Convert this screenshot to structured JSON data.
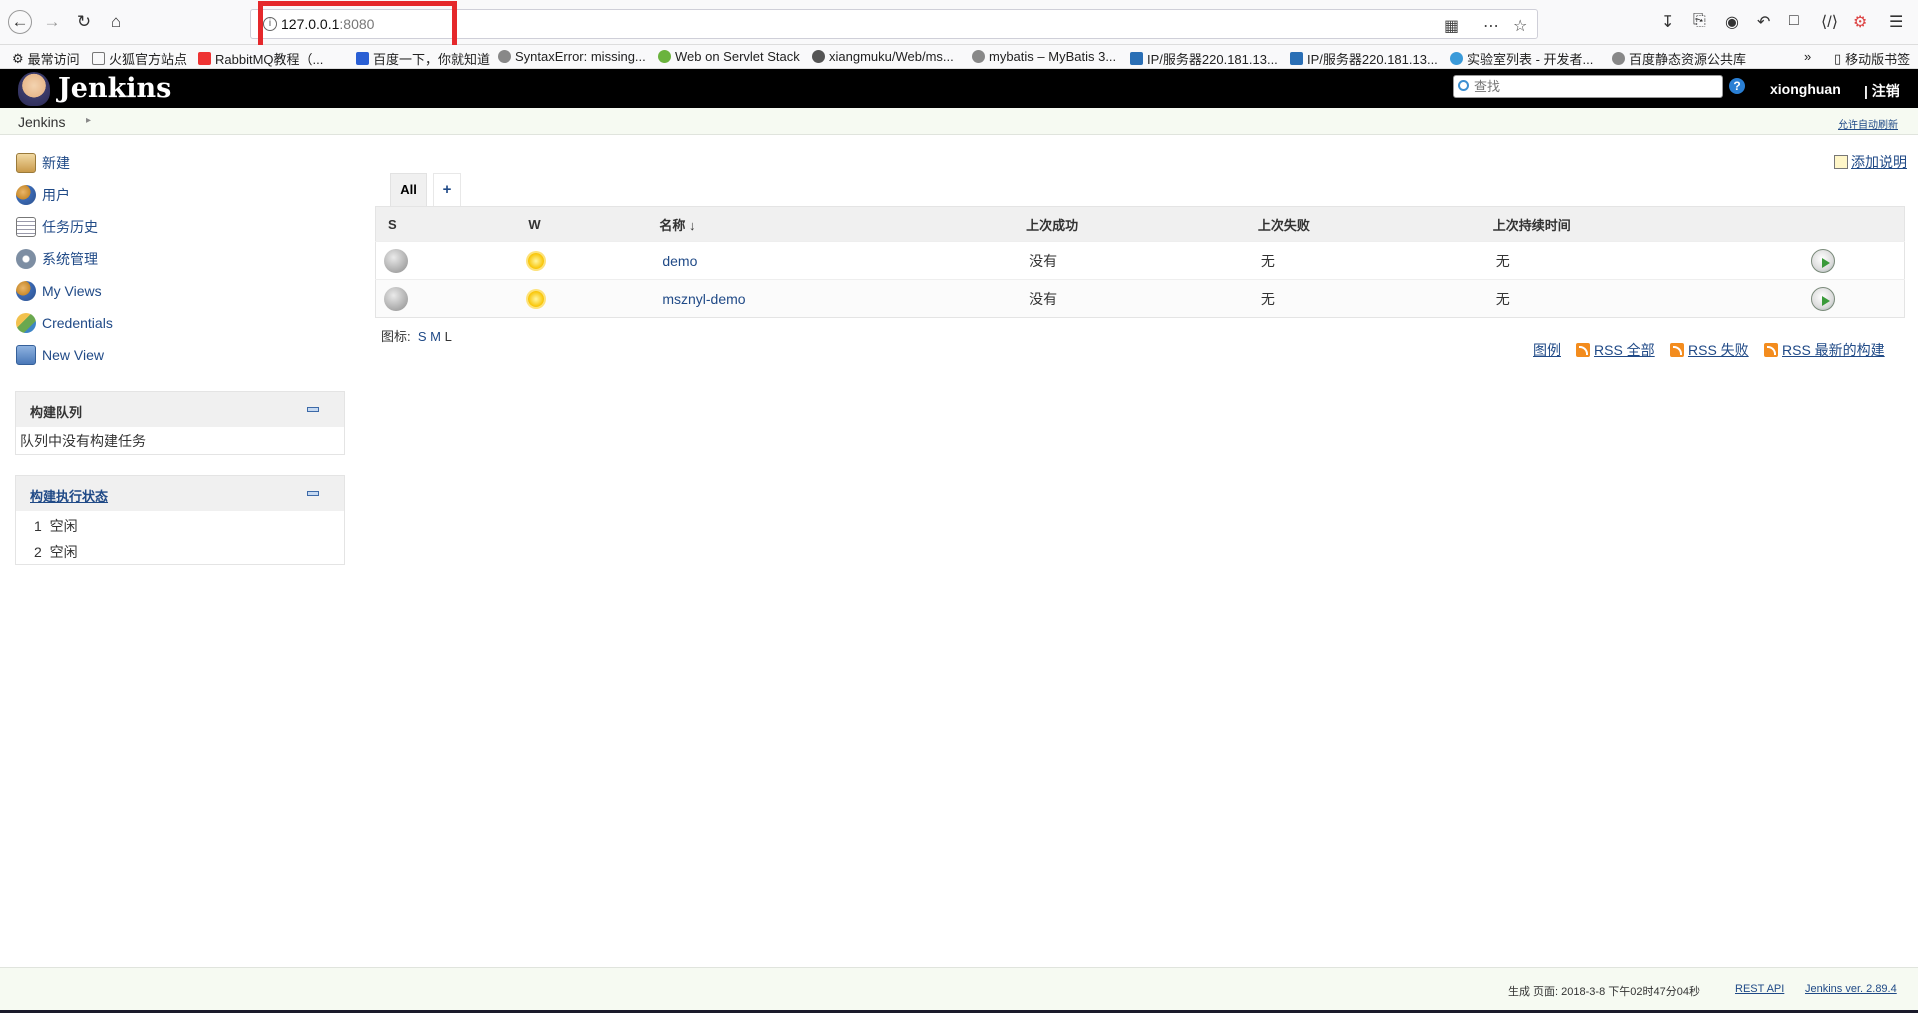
{
  "browser": {
    "url_host": "127.0.0.1",
    "url_port": ":8080",
    "bookmarks": [
      "最常访问",
      "火狐官方站点",
      "RabbitMQ教程（...",
      "百度一下，你就知道",
      "SyntaxError: missing...",
      "Web on Servlet Stack",
      "xiangmuku/Web/ms...",
      "mybatis – MyBatis 3...",
      "IP/服务器220.181.13...",
      "IP/服务器220.181.13...",
      "实验室列表 - 开发者...",
      "百度静态资源公共库"
    ],
    "mobile_bookmarks": "移动版书签",
    "more": "»"
  },
  "header": {
    "title": "Jenkins",
    "search_placeholder": "查找",
    "help": "?",
    "user": "xionghuan",
    "logout": "| 注销"
  },
  "breadcrumb": {
    "root": "Jenkins",
    "auto_refresh": "允许自动刷新"
  },
  "sidebar": {
    "tasks": [
      {
        "label": "新建",
        "icon": "new-item-icon"
      },
      {
        "label": "用户",
        "icon": "people-icon"
      },
      {
        "label": "任务历史",
        "icon": "build-history-icon"
      },
      {
        "label": "系统管理",
        "icon": "manage-jenkins-icon"
      },
      {
        "label": "My Views",
        "icon": "my-views-icon"
      },
      {
        "label": "Credentials",
        "icon": "credentials-icon"
      },
      {
        "label": "New View",
        "icon": "new-view-icon"
      }
    ],
    "build_queue": {
      "title": "构建队列",
      "empty": "队列中没有构建任务"
    },
    "executors": {
      "title": "构建执行状态",
      "items": [
        {
          "num": "1",
          "status": "空闲"
        },
        {
          "num": "2",
          "status": "空闲"
        }
      ]
    }
  },
  "main": {
    "add_description": "添加说明",
    "tabs": {
      "all": "All",
      "add": "+"
    },
    "columns": [
      "S",
      "W",
      "名称 ↓",
      "上次成功",
      "上次失败",
      "上次持续时间"
    ],
    "jobs": [
      {
        "name": "demo",
        "last_success": "没有",
        "last_failure": "无",
        "last_duration": "无"
      },
      {
        "name": "msznyl-demo",
        "last_success": "没有",
        "last_failure": "无",
        "last_duration": "无"
      }
    ],
    "icon_size": {
      "label": "图标:",
      "s": "S",
      "m": "M",
      "l": "L"
    },
    "legend": "图例",
    "rss": [
      "RSS 全部",
      "RSS 失败",
      "RSS 最新的构建"
    ]
  },
  "footer": {
    "generated": "生成 页面: 2018-3-8 下午02时47分04秒",
    "rest_api": "REST API",
    "version": "Jenkins ver. 2.89.4"
  },
  "colors": {
    "header_bg": "#000000",
    "link": "#204a87",
    "highlight": "#e5282b"
  }
}
